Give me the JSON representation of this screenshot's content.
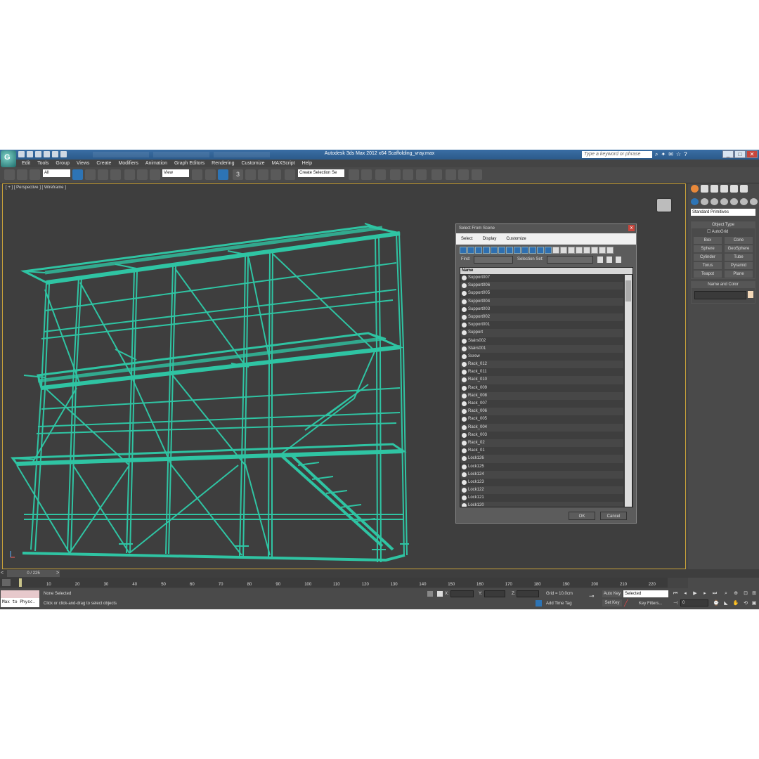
{
  "window": {
    "title": "Autodesk 3ds Max 2012 x64     Scaffolding_vray.max",
    "search_placeholder": "Type a keyword or phrase",
    "logo_glyph": "G",
    "minimize": "_",
    "maximize": "□",
    "close": "✕"
  },
  "menu": [
    "Edit",
    "Tools",
    "Group",
    "Views",
    "Create",
    "Modifiers",
    "Animation",
    "Graph Editors",
    "Rendering",
    "Customize",
    "MAXScript",
    "Help"
  ],
  "toolbar": {
    "selection_filter": "All",
    "reference_coord": "View",
    "named_selection": "Create Selection Se",
    "snap_label": "3"
  },
  "viewport": {
    "label": "[ + ] [ Perspective ] [ Wireframe ]",
    "wire_color": "#2fc4a3"
  },
  "dialog": {
    "title": "Select From Scene",
    "close": "x",
    "menu": [
      "Select",
      "Display",
      "Customize"
    ],
    "find_label": "Find:",
    "selection_set_label": "Selection Set:",
    "column_header": "Name",
    "items": [
      "Support007",
      "Support006",
      "Support005",
      "Support004",
      "Support003",
      "Support002",
      "Support001",
      "Support",
      "Stairs002",
      "Stairs001",
      "Screw",
      "Rack_012",
      "Rack_011",
      "Rack_010",
      "Rack_009",
      "Rack_008",
      "Rack_007",
      "Rack_006",
      "Rack_005",
      "Rack_004",
      "Rack_003",
      "Rack_02",
      "Rack_01",
      "Lock126",
      "Lock125",
      "Lock124",
      "Lock123",
      "Lock122",
      "Lock121",
      "Lock120"
    ],
    "ok": "OK",
    "cancel": "Cancel"
  },
  "command_panel": {
    "category": "Standard Primitives",
    "object_type_header": "Object Type",
    "autogrid": "AutoGrid",
    "primitives": [
      "Box",
      "Cone",
      "Sphere",
      "GeoSphere",
      "Cylinder",
      "Tube",
      "Torus",
      "Pyramid",
      "Teapot",
      "Plane"
    ],
    "name_color_header": "Name and Color"
  },
  "timeline": {
    "frame_label": "0 / 225",
    "ticks": [
      "10",
      "20",
      "30",
      "40",
      "50",
      "60",
      "70",
      "80",
      "90",
      "100",
      "110",
      "120",
      "130",
      "140",
      "150",
      "160",
      "170",
      "180",
      "190",
      "200",
      "210",
      "220"
    ]
  },
  "status": {
    "maxscript": "Max to Physc.",
    "selection": "None Selected",
    "prompt": "Click or click-and-drag to select objects",
    "x_label": "X:",
    "y_label": "Y:",
    "z_label": "Z:",
    "grid": "Grid = 10,0cm",
    "add_time_tag": "Add Time Tag",
    "auto_key": "Auto Key",
    "set_key": "Set Key",
    "key_mode": "Selected",
    "key_filters": "Key Filters...",
    "current_frame": "0"
  }
}
